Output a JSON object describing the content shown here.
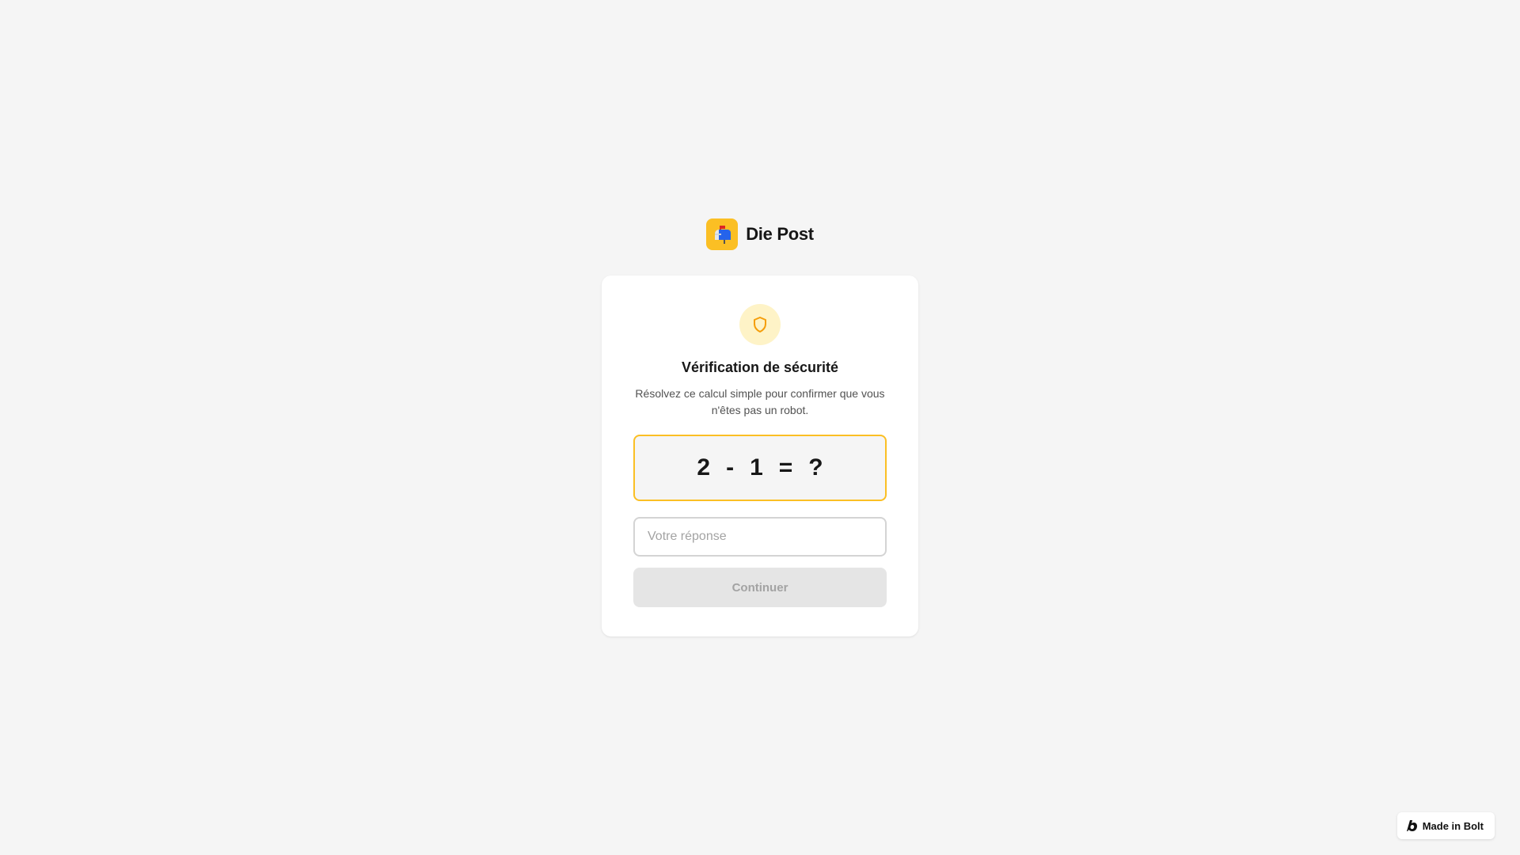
{
  "brand": {
    "name": "Die Post",
    "logo_icon": "mailbox-icon",
    "logo_color": "#fbbf24"
  },
  "card": {
    "icon": "shield-icon",
    "title": "Vérification de sécurité",
    "subtitle": "Résolvez ce calcul simple pour confirmer que vous n'êtes pas un robot.",
    "challenge": {
      "operand_a": "2",
      "operator": "-",
      "operand_b": "1",
      "equals": "=",
      "unknown": "?"
    },
    "answer": {
      "value": "",
      "placeholder": "Votre réponse"
    },
    "continue_label": "Continuer"
  },
  "badge": {
    "label": "Made in Bolt",
    "icon": "bolt-logo-icon"
  },
  "colors": {
    "accent": "#fbbf24",
    "accent_soft": "#fef3c7",
    "background": "#f5f5f5"
  }
}
